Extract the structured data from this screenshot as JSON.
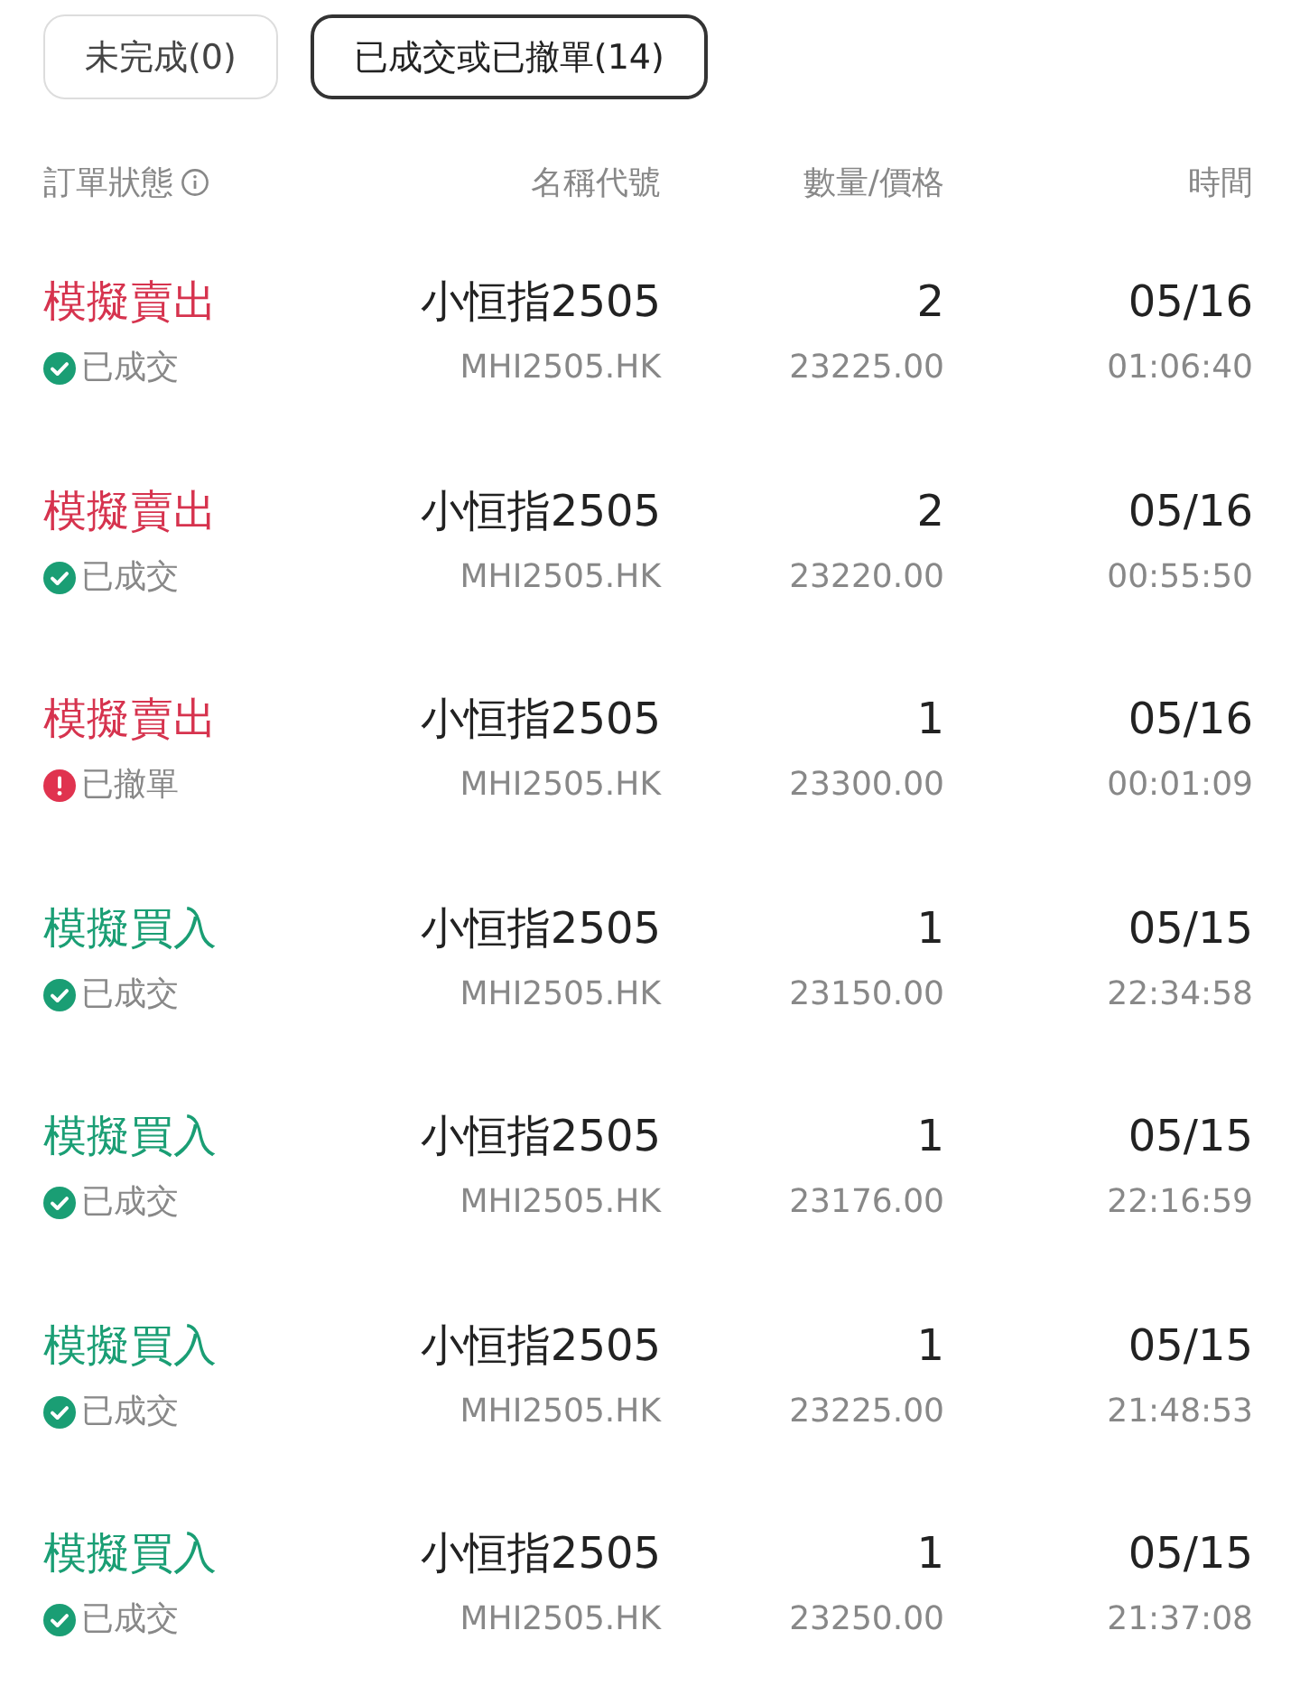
{
  "tabs": [
    {
      "label": "未完成(0)",
      "selected": false
    },
    {
      "label": "已成交或已撤單(14)",
      "selected": true
    }
  ],
  "columns": [
    "訂單狀態",
    "名稱代號",
    "數量/價格",
    "時間"
  ],
  "orders": [
    {
      "side": {
        "text": "模擬賣出",
        "kind": "sell"
      },
      "status": {
        "text": "已成交",
        "kind": "filled"
      },
      "name": "小恒指2505",
      "code": "MHI2505.HK",
      "quantity": "2",
      "price": "23225.00",
      "date": "05/16",
      "time": "01:06:40"
    },
    {
      "side": {
        "text": "模擬賣出",
        "kind": "sell"
      },
      "status": {
        "text": "已成交",
        "kind": "filled"
      },
      "name": "小恒指2505",
      "code": "MHI2505.HK",
      "quantity": "2",
      "price": "23220.00",
      "date": "05/16",
      "time": "00:55:50"
    },
    {
      "side": {
        "text": "模擬賣出",
        "kind": "sell"
      },
      "status": {
        "text": "已撤單",
        "kind": "cancelled"
      },
      "name": "小恒指2505",
      "code": "MHI2505.HK",
      "quantity": "1",
      "price": "23300.00",
      "date": "05/16",
      "time": "00:01:09"
    },
    {
      "side": {
        "text": "模擬買入",
        "kind": "buy"
      },
      "status": {
        "text": "已成交",
        "kind": "filled"
      },
      "name": "小恒指2505",
      "code": "MHI2505.HK",
      "quantity": "1",
      "price": "23150.00",
      "date": "05/15",
      "time": "22:34:58"
    },
    {
      "side": {
        "text": "模擬買入",
        "kind": "buy"
      },
      "status": {
        "text": "已成交",
        "kind": "filled"
      },
      "name": "小恒指2505",
      "code": "MHI2505.HK",
      "quantity": "1",
      "price": "23176.00",
      "date": "05/15",
      "time": "22:16:59"
    },
    {
      "side": {
        "text": "模擬買入",
        "kind": "buy"
      },
      "status": {
        "text": "已成交",
        "kind": "filled"
      },
      "name": "小恒指2505",
      "code": "MHI2505.HK",
      "quantity": "1",
      "price": "23225.00",
      "date": "05/15",
      "time": "21:48:53"
    },
    {
      "side": {
        "text": "模擬買入",
        "kind": "buy"
      },
      "status": {
        "text": "已成交",
        "kind": "filled"
      },
      "name": "小恒指2505",
      "code": "MHI2505.HK",
      "quantity": "1",
      "price": "23250.00",
      "date": "05/15",
      "time": "21:37:08"
    }
  ]
}
